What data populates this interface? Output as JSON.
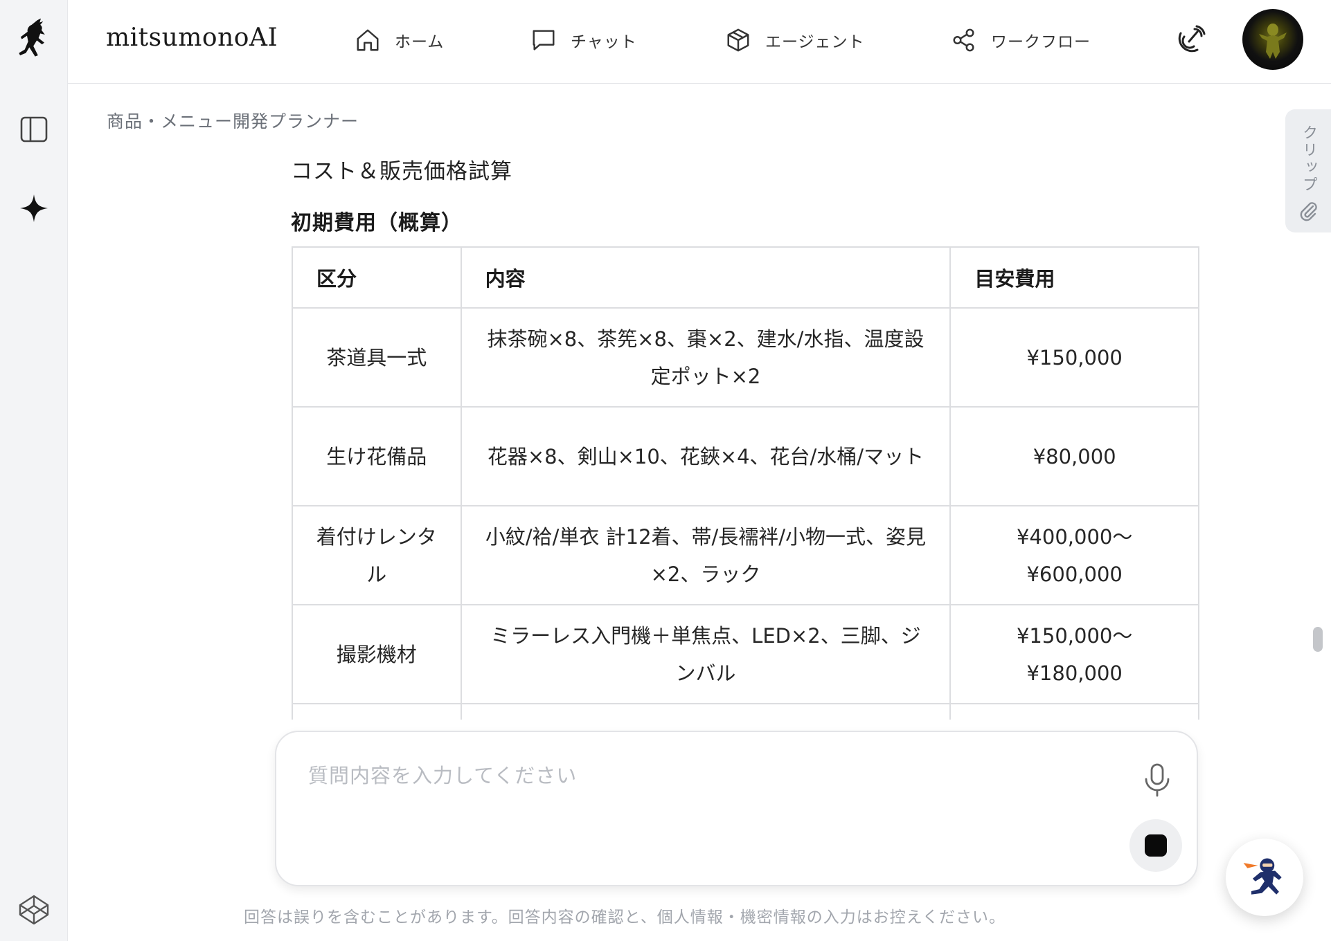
{
  "app": {
    "brand": "mitsumonoAI"
  },
  "nav": [
    {
      "label": "ホーム",
      "icon": "home-icon"
    },
    {
      "label": "チャット",
      "icon": "chat-icon"
    },
    {
      "label": "エージェント",
      "icon": "cube-icon"
    },
    {
      "label": "ワークフロー",
      "icon": "share-icon"
    }
  ],
  "breadcrumb": "商品・メニュー開発プランナー",
  "content": {
    "subtitle": "コスト＆販売価格試算",
    "section_title": "初期費用（概算）",
    "table": {
      "headers": [
        "区分",
        "内容",
        "目安費用"
      ],
      "rows": [
        [
          "茶道具一式",
          "抹茶碗×8、茶筅×8、棗×2、建水/水指、温度設定ポット×2",
          "¥150,000"
        ],
        [
          "生け花備品",
          "花器×8、剣山×10、花鋏×4、花台/水桶/マット",
          "¥80,000"
        ],
        [
          "着付けレンタル",
          "小紋/袷/単衣 計12着、帯/長襦袢/小物一式、姿見×2、ラック",
          "¥400,000〜¥600,000"
        ],
        [
          "撮影機材",
          "ミラーレス入門機＋単焦点、LED×2、三脚、ジンバル",
          "¥150,000〜¥180,000"
        ],
        [
          "",
          "",
          ""
        ]
      ]
    }
  },
  "clip_tab": {
    "label": "クリップ"
  },
  "input": {
    "placeholder": "質問内容を入力してください",
    "value": ""
  },
  "disclaimer": "回答は誤りを含むことがあります。回答内容の確認と、個人情報・機密情報の入力はお控えください。"
}
